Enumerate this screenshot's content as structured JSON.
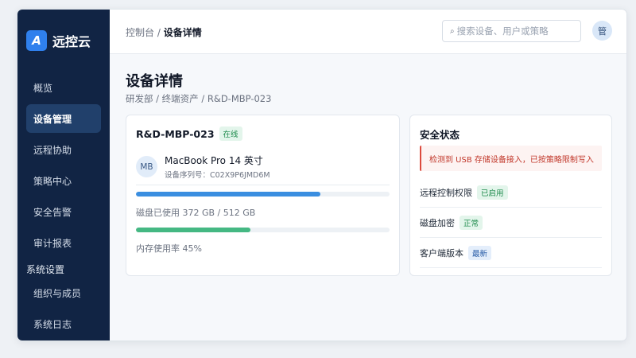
{
  "brand": {
    "logo_letter": "A",
    "name": "远控云"
  },
  "sidebar": {
    "items": [
      {
        "label": "概览"
      },
      {
        "label": "设备管理"
      },
      {
        "label": "远程协助"
      },
      {
        "label": "策略中心"
      },
      {
        "label": "安全告警"
      },
      {
        "label": "审计报表"
      }
    ],
    "section": "系统设置",
    "sub_items": [
      {
        "label": "组织与成员"
      },
      {
        "label": "系统日志"
      }
    ]
  },
  "header": {
    "breadcrumb_parent": "控制台",
    "breadcrumb_sep": "/",
    "breadcrumb_current": "设备详情",
    "search_placeholder": "搜索设备、用户或策略",
    "avatar_text": "管"
  },
  "page": {
    "title": "设备详情",
    "path": "研发部 / 终端资产 / R&D-MBP-023"
  },
  "device": {
    "name": "R&D-MBP-023",
    "status": "在线",
    "avatar": "MB",
    "model": "MacBook Pro 14 英寸",
    "serial": "设备序列号：C02X9P6JMD6M",
    "disk_label": "磁盘已使用 372 GB / 512 GB",
    "disk_fraction": 0.727,
    "memory_label": "内存使用率 45%",
    "memory_fraction": 0.45
  },
  "security": {
    "title": "安全状态",
    "alert": "检测到 USB 存储设备接入，已按策略限制写入",
    "rows": [
      {
        "label": "远程控制权限",
        "badge": "已启用"
      },
      {
        "label": "磁盘加密",
        "badge": "正常"
      },
      {
        "label": "客户端版本",
        "badge": "最新"
      }
    ]
  },
  "colors": {
    "sidebar_bg": "#112444",
    "accent": "#2f80ed",
    "disk_bar": "#3a8ee0",
    "memory_bar": "#45b883",
    "alert": "#dc4a3d",
    "success": "#1d8a4b"
  }
}
